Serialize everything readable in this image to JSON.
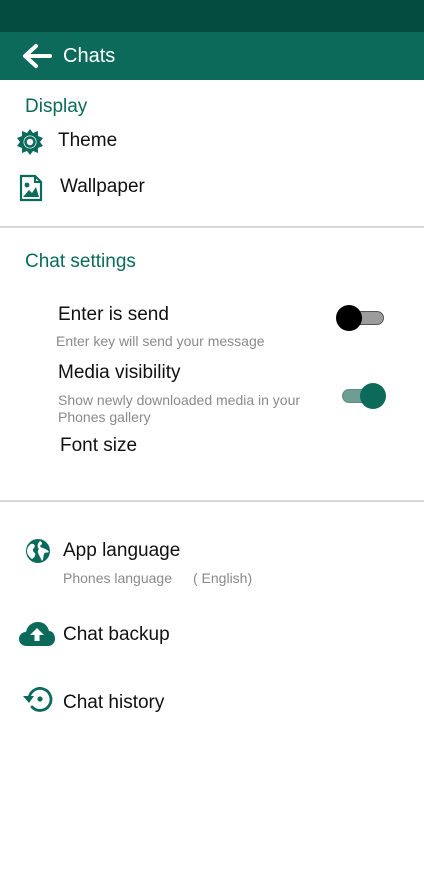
{
  "header": {
    "title": "Chats"
  },
  "display": {
    "section_label": "Display",
    "theme_label": "Theme",
    "wallpaper_label": "Wallpaper"
  },
  "chat_settings": {
    "section_label": "Chat settings",
    "enter_is_send": {
      "label": "Enter is send",
      "description": "Enter key will send your message",
      "enabled": false
    },
    "media_visibility": {
      "label": "Media visibility",
      "description_line1": "Show newly downloaded media in your",
      "description_line2": "Phones gallery",
      "enabled": true
    },
    "font_size_label": "Font size"
  },
  "other": {
    "app_language_label": "App language",
    "app_language_value": "Phones language",
    "app_language_current": "( English)",
    "chat_backup_label": "Chat backup",
    "chat_history_label": "Chat history"
  },
  "colors": {
    "status_bar": "#054c40",
    "app_bar": "#0b6a5a",
    "accent": "#0b6a5a"
  },
  "icons": [
    "back-arrow-icon",
    "theme-gear-icon",
    "wallpaper-image-icon",
    "globe-icon",
    "cloud-upload-icon",
    "history-icon"
  ]
}
